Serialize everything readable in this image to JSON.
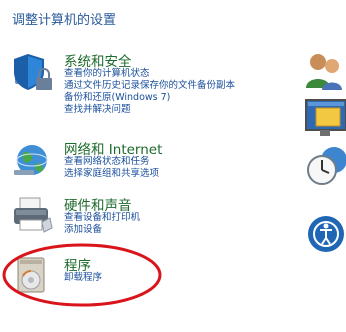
{
  "page": {
    "heading": "调整计算机的设置"
  },
  "categories": [
    {
      "title": "系统和安全",
      "icon": "shield-icon",
      "links": [
        "查看你的计算机状态",
        "通过文件历史记录保存你的文件备份副本",
        "备份和还原(Windows 7)",
        "查找并解决问题"
      ]
    },
    {
      "title": "网络和 Internet",
      "icon": "network-globe-icon",
      "links": [
        "查看网络状态和任务",
        "选择家庭组和共享选项"
      ]
    },
    {
      "title": "硬件和声音",
      "icon": "printer-icon",
      "links": [
        "查看设备和打印机",
        "添加设备"
      ]
    },
    {
      "title": "程序",
      "icon": "programs-disc-icon",
      "links": [
        "卸载程序"
      ]
    }
  ],
  "right_column_icons": [
    "user-accounts-icon",
    "appearance-icon",
    "clock-globe-icon",
    "ease-of-access-icon"
  ],
  "annotation": {
    "shape": "ellipse",
    "color": "#d9141b",
    "target": "程序"
  }
}
